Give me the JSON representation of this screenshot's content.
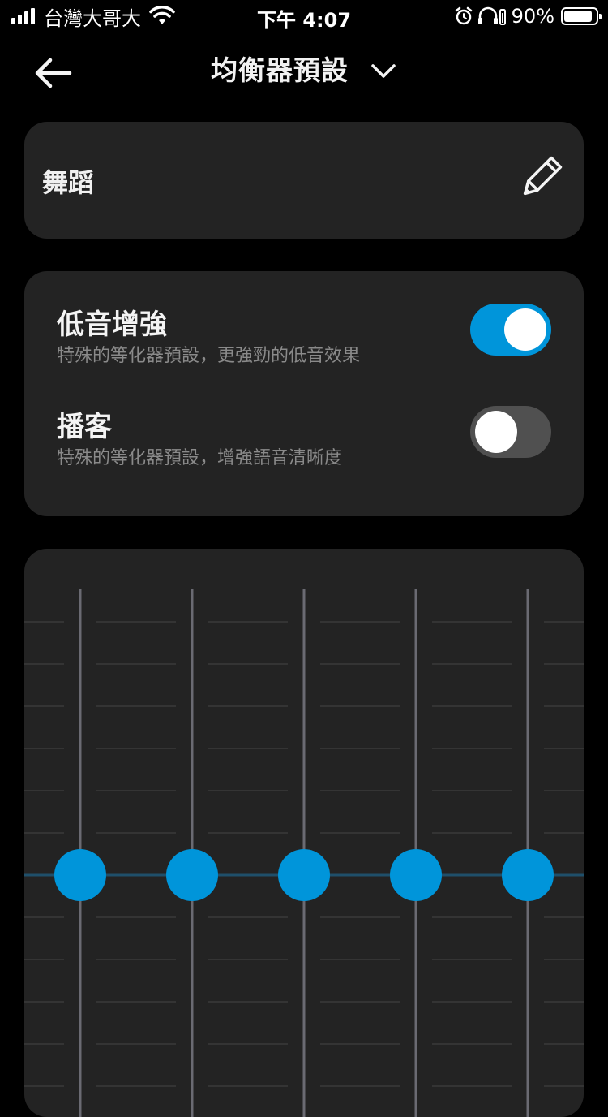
{
  "status_bar": {
    "carrier": "台灣大哥大",
    "time": "下午 4:07",
    "battery_percent": "90%",
    "battery_level": 0.9,
    "icons": [
      "signal-icon",
      "wifi-icon",
      "alarm-icon",
      "headphones-battery-icon",
      "battery-icon"
    ]
  },
  "header": {
    "title": "均衡器預設",
    "icons": [
      "back-arrow-icon",
      "chevron-down-icon"
    ]
  },
  "preset": {
    "name": "舞蹈",
    "icon": "pencil-icon"
  },
  "toggles": [
    {
      "title": "低音增強",
      "subtitle": "特殊的等化器預設，更強勁的低音效果",
      "on": true
    },
    {
      "title": "播客",
      "subtitle": "特殊的等化器預設，增強語音清晰度",
      "on": false
    }
  ],
  "equalizer": {
    "bands": [
      {
        "level": 0
      },
      {
        "level": 0
      },
      {
        "level": 0
      },
      {
        "level": 0
      },
      {
        "level": 0
      }
    ],
    "accent_color": "#0095da"
  }
}
